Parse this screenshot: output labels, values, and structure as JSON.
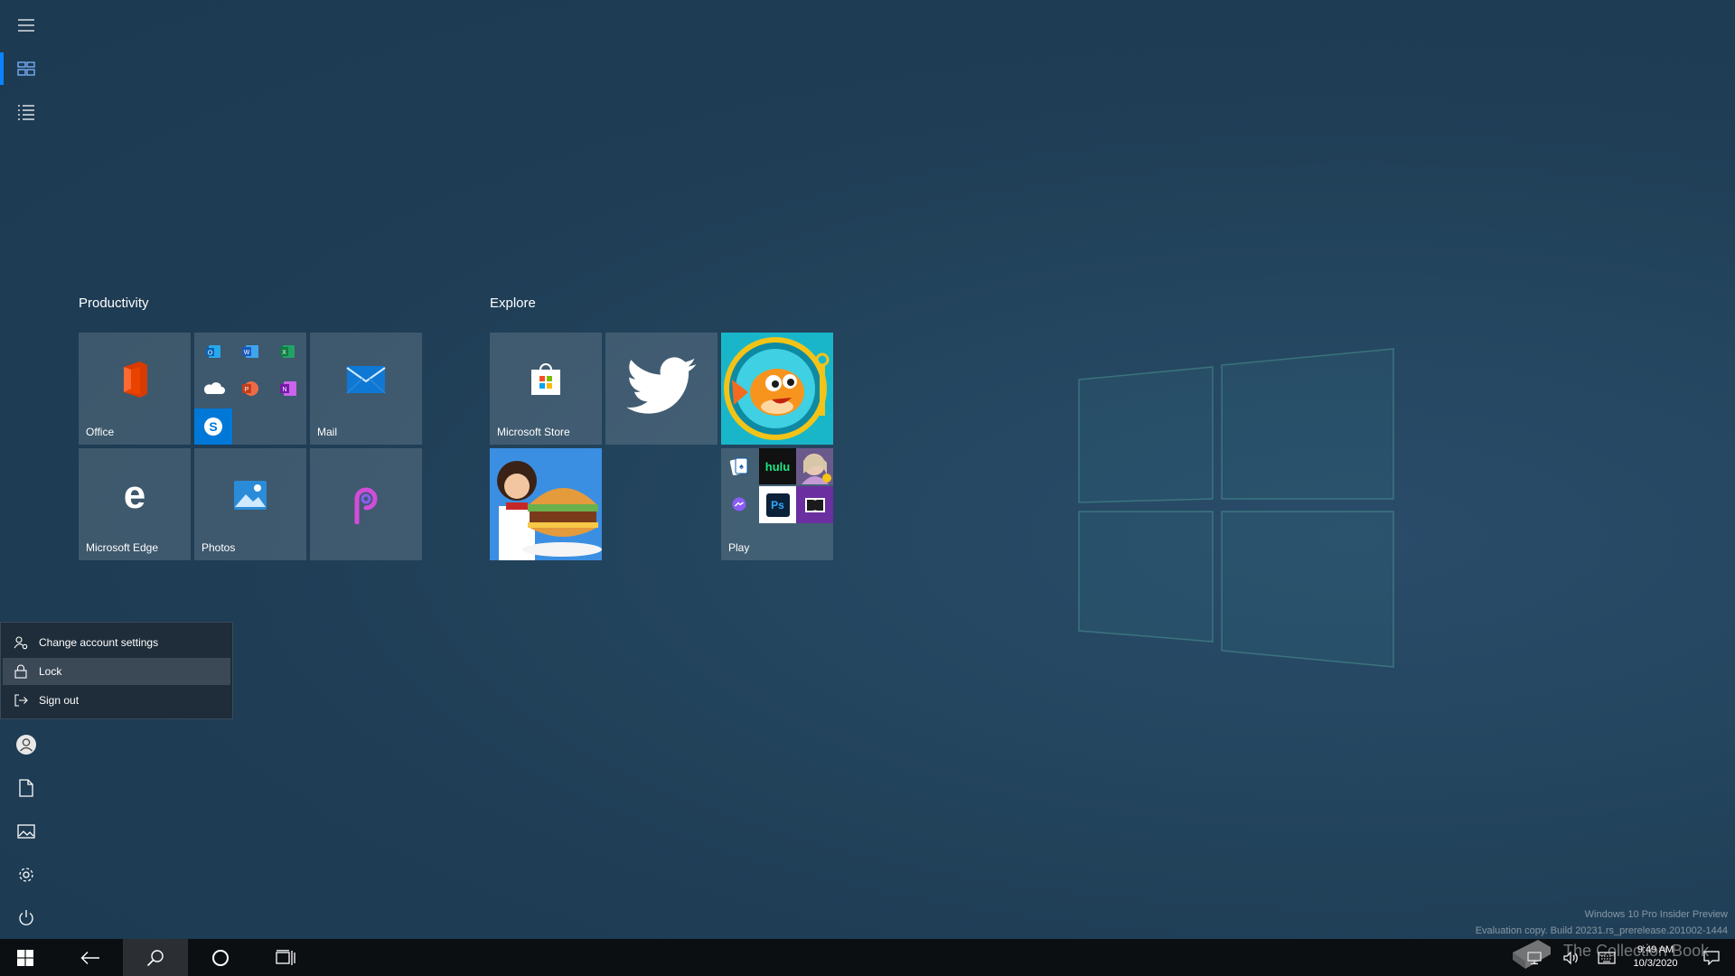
{
  "groups": {
    "productivity": {
      "title": "Productivity"
    },
    "explore": {
      "title": "Explore"
    }
  },
  "tiles": {
    "office": "Office",
    "mail": "Mail",
    "edge": "Microsoft Edge",
    "photos": "Photos",
    "store": "Microsoft Store",
    "play": "Play"
  },
  "play_folder": {
    "hulu": "hulu",
    "ps": "Ps"
  },
  "flyout": {
    "items": [
      {
        "label": "Change account settings",
        "icon": "account-settings-icon"
      },
      {
        "label": "Lock",
        "icon": "lock-icon"
      },
      {
        "label": "Sign out",
        "icon": "sign-out-icon"
      }
    ]
  },
  "tray": {
    "time": "9:49 AM",
    "date": "10/3/2020"
  },
  "watermark": {
    "line1": "Windows 10 Pro Insider Preview",
    "line2": "Evaluation copy. Build 20231.rs_prerelease.201002-1444",
    "brand": "The Collection Book"
  },
  "colors": {
    "accent": "#0a84ff",
    "office_red": "#d83b01",
    "mail_blue": "#0078d7",
    "twitter_blue": "#1da1f2",
    "taskbar": "#0c0f12"
  }
}
